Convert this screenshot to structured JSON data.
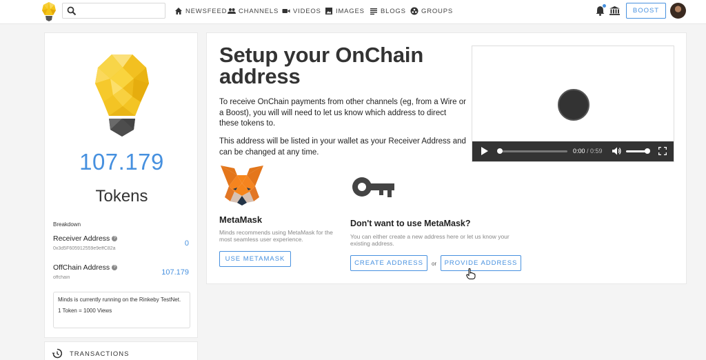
{
  "nav": {
    "items": [
      {
        "label": "NEWSFEED",
        "icon": "home-icon"
      },
      {
        "label": "CHANNELS",
        "icon": "people-icon"
      },
      {
        "label": "VIDEOS",
        "icon": "video-camera-icon"
      },
      {
        "label": "IMAGES",
        "icon": "image-icon"
      },
      {
        "label": "BLOGS",
        "icon": "list-icon"
      },
      {
        "label": "GROUPS",
        "icon": "groups-icon"
      }
    ],
    "search_placeholder": "",
    "boost_label": "BOOST"
  },
  "wallet": {
    "balance": "107.179",
    "unit": "Tokens",
    "breakdown_label": "Breakdown",
    "receiver": {
      "title": "Receiver Address",
      "address": "0x3d5F605912559e9effC82a",
      "value": "0"
    },
    "offchain": {
      "title": "OffChain Address",
      "sub": "offchain",
      "value": "107.179"
    },
    "notice_line1": "Minds is currently running on the Rinkeby TestNet.",
    "notice_line2": "1 Token = 1000 Views",
    "transactions_label": "TRANSACTIONS"
  },
  "setup": {
    "title": "Setup your OnChain address",
    "para1": "To receive OnChain payments from other channels (eg, from a Wire or a Boost), you will will need to let us know which address to direct these tokens to.",
    "para2": "This address will be listed in your wallet as your Receiver Address and can be changed at any time.",
    "video": {
      "current": "0:00",
      "separator": " / ",
      "duration": "0:59",
      "progress": 0
    },
    "metamask": {
      "title": "MetaMask",
      "desc": "Minds recommends using MetaMask for the most seamless user experience.",
      "button": "USE METAMASK"
    },
    "alternative": {
      "title": "Don't want to use MetaMask?",
      "desc": "You can either create a new address here or let us know your existing address.",
      "create_button": "CREATE ADDRESS",
      "or_label": "or",
      "provide_button": "PROVIDE ADDRESS"
    }
  },
  "colors": {
    "accent": "#4690df",
    "bulb_yellow": "#f5c518"
  }
}
